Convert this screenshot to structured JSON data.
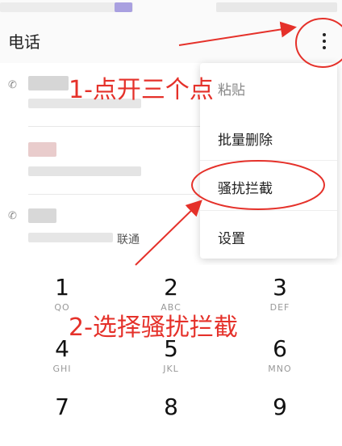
{
  "header": {
    "title": "电话"
  },
  "call_list": {
    "carrier_text": "联通"
  },
  "menu": {
    "items": [
      {
        "label": "粘贴"
      },
      {
        "label": "批量删除"
      },
      {
        "label": "骚扰拦截"
      },
      {
        "label": "设置"
      }
    ]
  },
  "dialpad": {
    "keys": [
      {
        "digit": "1",
        "letters": "QO"
      },
      {
        "digit": "2",
        "letters": "ABC"
      },
      {
        "digit": "3",
        "letters": "DEF"
      },
      {
        "digit": "4",
        "letters": "GHI"
      },
      {
        "digit": "5",
        "letters": "JKL"
      },
      {
        "digit": "6",
        "letters": "MNO"
      },
      {
        "digit": "7",
        "letters": ""
      },
      {
        "digit": "8",
        "letters": ""
      },
      {
        "digit": "9",
        "letters": ""
      }
    ]
  },
  "annotations": {
    "step1": "1-点开三个点",
    "step2": "2-选择骚扰拦截",
    "color": "#e5312a"
  }
}
